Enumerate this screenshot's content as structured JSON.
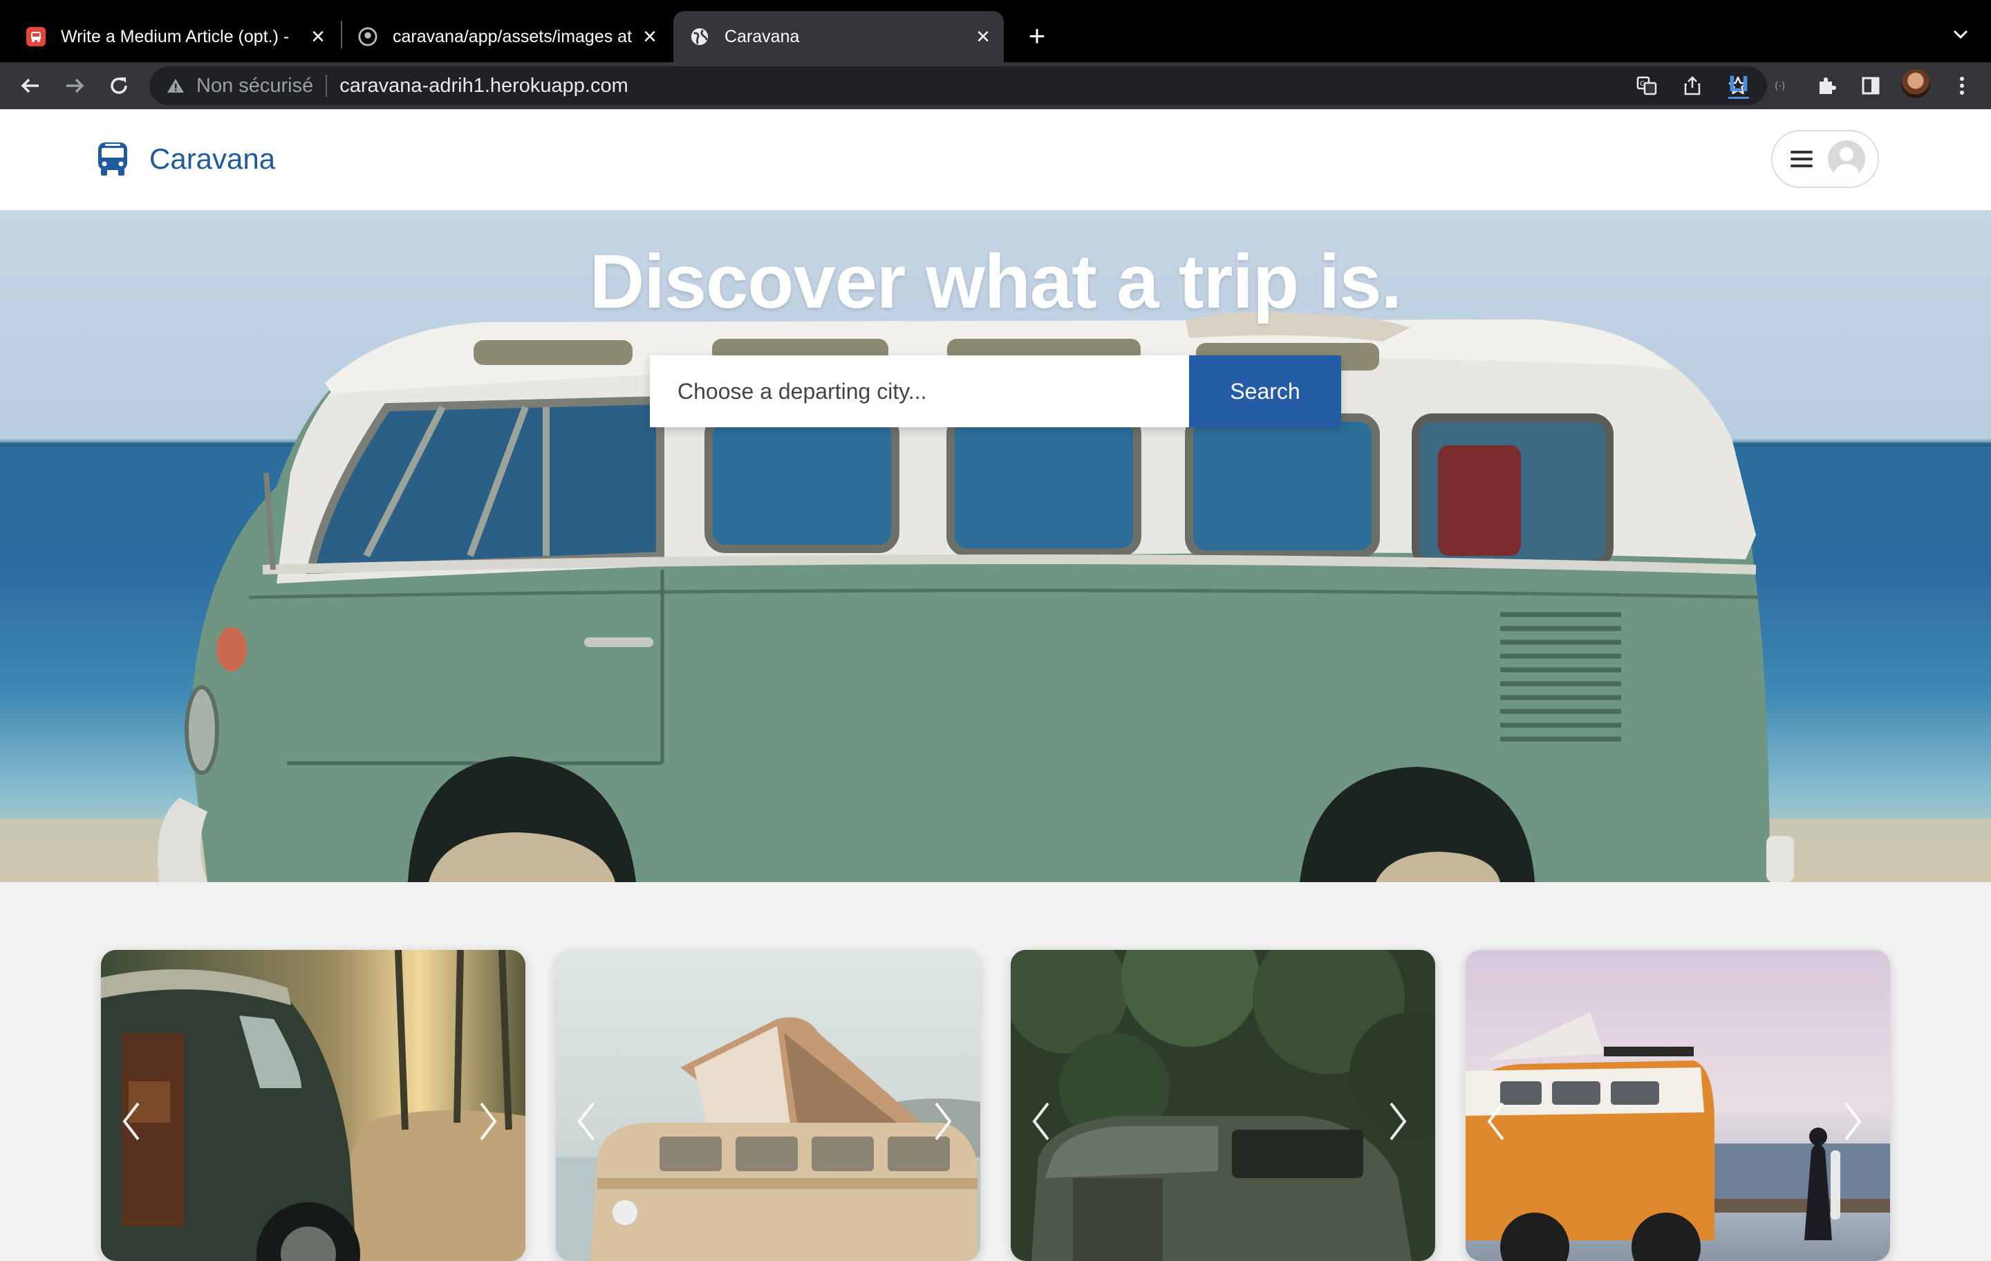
{
  "browser": {
    "tabs": [
      {
        "title": "Write a Medium Article (opt.) - ",
        "icon": "bus-app-icon",
        "active": false
      },
      {
        "title": "caravana/app/assets/images at",
        "icon": "github-icon",
        "active": false
      },
      {
        "title": "Caravana",
        "icon": "globe-icon",
        "active": true
      }
    ],
    "security_label": "Non sécurisé",
    "url": "caravana-adrih1.herokuapp.com",
    "extension_label": "LI"
  },
  "site": {
    "brand_name": "Caravana",
    "brand_color": "#1f5b9e",
    "hero_title": "Discover what a trip is.",
    "search": {
      "placeholder": "Choose a departing city...",
      "button_label": "Search",
      "button_color": "#245ca6"
    }
  },
  "cards": [
    {
      "name": "green-van-forest-card"
    },
    {
      "name": "beige-camper-coast-card"
    },
    {
      "name": "green-van-woods-card"
    },
    {
      "name": "orange-van-beach-card"
    }
  ]
}
